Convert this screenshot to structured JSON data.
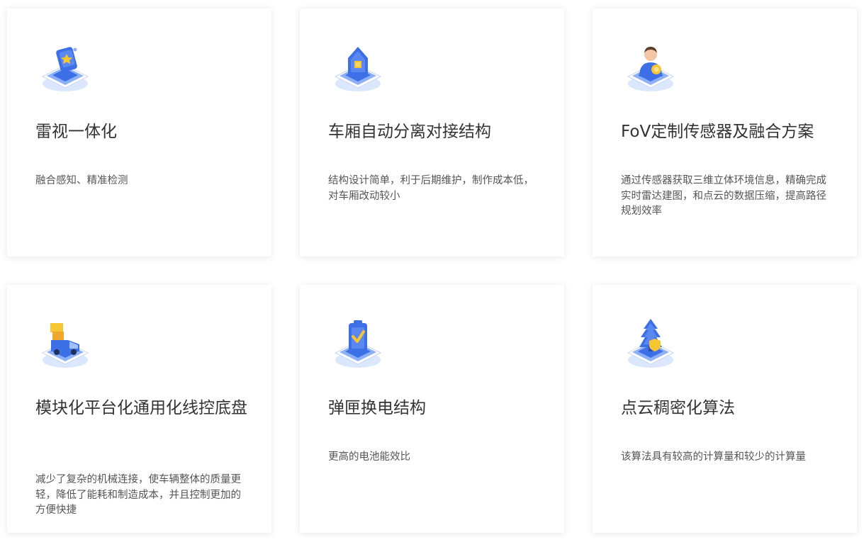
{
  "cards": [
    {
      "icon": "radar-badge-icon",
      "title": "雷视一体化",
      "description": "融合感知、精准检测"
    },
    {
      "icon": "house-box-icon",
      "title": "车厢自动分离对接结构",
      "description": "结构设计简单，利于后期维护，制作成本低，对车厢改动较小"
    },
    {
      "icon": "engineer-sensor-icon",
      "title": "FoV定制传感器及融合方案",
      "description": "通过传感器获取三维立体环境信息，精确完成实时雷达建图，和点云的数据压缩，提高路径规划效率"
    },
    {
      "icon": "delivery-truck-icon",
      "title": "模块化平台化通用化线控底盘",
      "description": "减少了复杂的机械连接，使车辆整体的质量更轻，降低了能耗和制造成本，并且控制更加的方便快捷"
    },
    {
      "icon": "battery-check-icon",
      "title": "弹匣换电结构",
      "description": "更高的电池能效比"
    },
    {
      "icon": "tree-shield-icon",
      "title": "点云稠密化算法",
      "description": "该算法具有较高的计算量和较少的计算量"
    }
  ],
  "colors": {
    "accent_blue": "#3d6fe6",
    "light_blue": "#8db0f7",
    "pale_blue": "#dbe7fd",
    "gold": "#f5c533",
    "title_text": "#333333",
    "body_text": "#555555"
  }
}
